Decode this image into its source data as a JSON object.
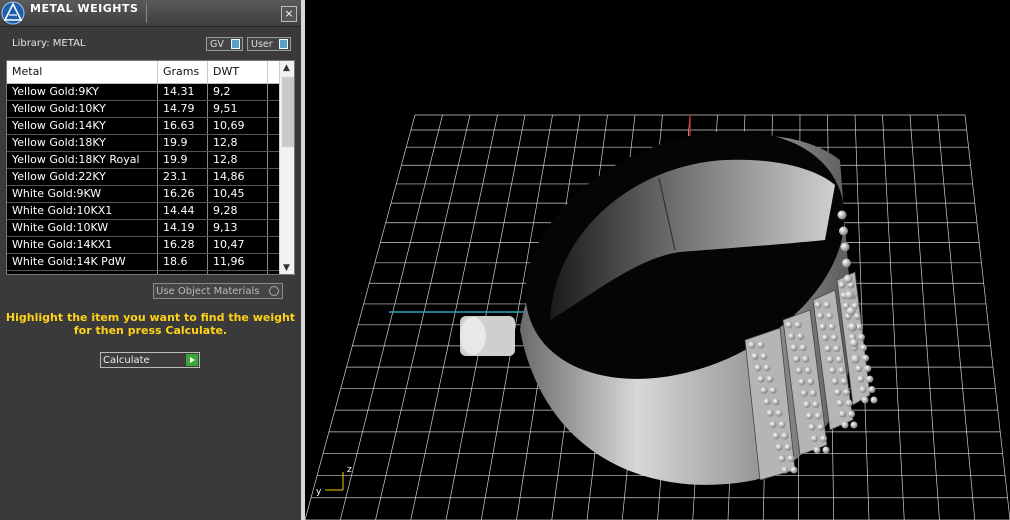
{
  "panel": {
    "title": "METAL WEIGHTS",
    "close_label": "×",
    "library_label": "Library: METAL",
    "gv_label": "GV",
    "user_label": "User",
    "columns": [
      "Metal",
      "Grams",
      "DWT"
    ],
    "rows": [
      [
        "Yellow Gold:9KY",
        "14.31",
        "9,2"
      ],
      [
        "Yellow Gold:10KY",
        "14.79",
        "9,51"
      ],
      [
        "Yellow Gold:14KY",
        "16.63",
        "10,69"
      ],
      [
        "Yellow Gold:18KY",
        "19.9",
        "12,8"
      ],
      [
        "Yellow Gold:18KY Royal",
        "19.9",
        "12,8"
      ],
      [
        "Yellow Gold:22KY",
        "23.1",
        "14,86"
      ],
      [
        "White Gold:9KW",
        "16.26",
        "10,45"
      ],
      [
        "White Gold:10KX1",
        "14.44",
        "9,28"
      ],
      [
        "White Gold:10KW",
        "14.19",
        "9,13"
      ],
      [
        "White Gold:14KX1",
        "16.28",
        "10,47"
      ],
      [
        "White Gold:14K PdW",
        "18.6",
        "11,96"
      ]
    ],
    "use_object_materials_label": "Use Object Materials",
    "instruction_line1": "Highlight the item you want to find the weight",
    "instruction_line2": "for then press Calculate.",
    "calculate_label": "Calculate"
  },
  "viewport": {
    "axis_z": "z",
    "axis_y": "y",
    "grid_color": "#cfcfcf",
    "axis_red": "#cc2020",
    "axis_cyan": "#2aa6b8"
  }
}
